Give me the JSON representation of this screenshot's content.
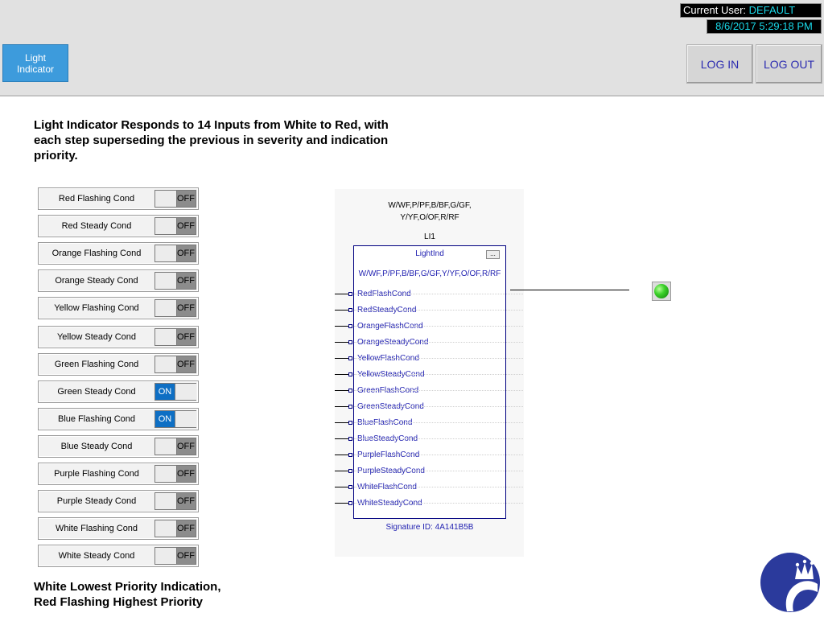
{
  "header": {
    "nav_button_label": "Light\nIndicator",
    "current_user_label": "Current User:",
    "current_user_value": "DEFAULT",
    "datetime": "8/6/2017 5:29:18 PM",
    "login_label": "LOG IN",
    "logout_label": "LOG OUT"
  },
  "description": "Light Indicator Responds to 14 Inputs from White to Red, with each step superseding the previous in severity and indication priority.",
  "footer_note_line1": "White Lowest Priority Indication,",
  "footer_note_line2": "Red Flashing Highest Priority",
  "toggles": [
    {
      "label": "Red Flashing Cond",
      "state": "OFF"
    },
    {
      "label": "Red Steady Cond",
      "state": "OFF"
    },
    {
      "label": "Orange Flashing Cond",
      "state": "OFF"
    },
    {
      "label": "Orange Steady Cond",
      "state": "OFF"
    },
    {
      "label": "Yellow Flashing Cond",
      "state": "OFF"
    },
    {
      "label": "Yellow Steady Cond",
      "state": "OFF"
    },
    {
      "label": "Green Flashing Cond",
      "state": "OFF"
    },
    {
      "label": "Green Steady Cond",
      "state": "ON"
    },
    {
      "label": "Blue Flashing Cond",
      "state": "ON"
    },
    {
      "label": "Blue Steady Cond",
      "state": "OFF"
    },
    {
      "label": "Purple Flashing Cond",
      "state": "OFF"
    },
    {
      "label": "Purple Steady Cond",
      "state": "OFF"
    },
    {
      "label": "White Flashing Cond",
      "state": "OFF"
    },
    {
      "label": "White Steady Cond",
      "state": "OFF"
    }
  ],
  "function_block": {
    "top_label": "W/WF,P/PF,B/BF,G/GF,\nY/YF,O/OF,R/RF",
    "tag": "LI1",
    "type": "LightInd",
    "more_button": "...",
    "sequence": "W/WF,P/PF,B/BF,G/GF,Y/YF,O/OF,R/RF",
    "inputs": [
      "RedFlashCond",
      "RedSteadyCond",
      "OrangeFlashCond",
      "OrangeSteadyCond",
      "YellowFlashCond",
      "YellowSteadyCond",
      "GreenFlashCond",
      "GreenSteadyCond",
      "BlueFlashCond",
      "BlueSteadyCond",
      "PurpleFlashCond",
      "PurpleSteadyCond",
      "WhiteFlashCond",
      "WhiteSteadyCond"
    ],
    "signature": "Signature ID: 4A141B5B"
  },
  "indicator": {
    "color": "#3cd12a",
    "icon": "green-lamp-icon"
  },
  "logo": {
    "icon": "crown-logo-icon",
    "color": "#2b3a9c"
  }
}
